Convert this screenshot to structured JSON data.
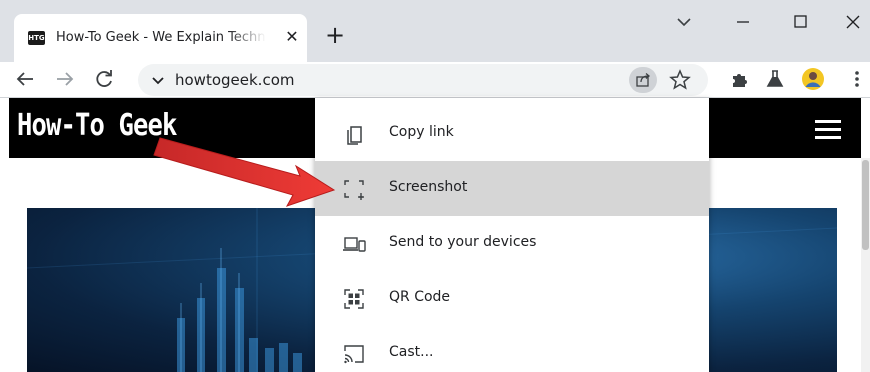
{
  "tab": {
    "favicon_text": "HTG",
    "title": "How-To Geek - We Explain Technology",
    "close_glyph": "✕"
  },
  "new_tab_glyph": "+",
  "omnibox": {
    "url": "howtogeek.com"
  },
  "page": {
    "logo_text": "How-To Geek"
  },
  "share_menu": {
    "items": [
      {
        "label": "Copy link",
        "icon": "copy-link-icon"
      },
      {
        "label": "Screenshot",
        "icon": "screenshot-icon",
        "highlighted": true
      },
      {
        "label": "Send to your devices",
        "icon": "send-to-devices-icon"
      },
      {
        "label": "QR Code",
        "icon": "qr-code-icon"
      },
      {
        "label": "Cast...",
        "icon": "cast-icon"
      }
    ]
  },
  "colors": {
    "tabstrip": "#dee1e6",
    "omnibox": "#f1f3f4",
    "menu_highlight": "#d6d6d6",
    "annotation_arrow": "#e53935",
    "site_header": "#000000"
  }
}
